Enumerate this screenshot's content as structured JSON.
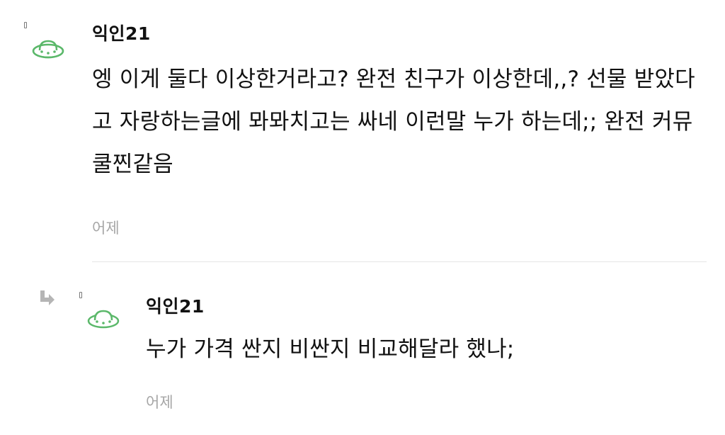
{
  "comments": [
    {
      "author": "익인21",
      "text": "엥 이게 둘다 이상한거라고? 완전 친구가 이상한데,,? 선물 받았다고 자랑하는글에 뫄뫄치고는 싸네 이런말 누가 하는데;; 완전 커뮤쿨찐같음",
      "time": "어제",
      "avatar_icon": "ufo-icon"
    },
    {
      "author": "익인21",
      "text": "누가 가격 싼지 비싼지 비교해달라 했나;",
      "time": "어제",
      "avatar_icon": "ufo-icon",
      "reply_icon": "reply-arrow-icon"
    }
  ],
  "colors": {
    "avatar_green": "#5bb86a",
    "time_gray": "#a6a6a6",
    "divider": "#e6e6e6",
    "text": "#111111"
  }
}
